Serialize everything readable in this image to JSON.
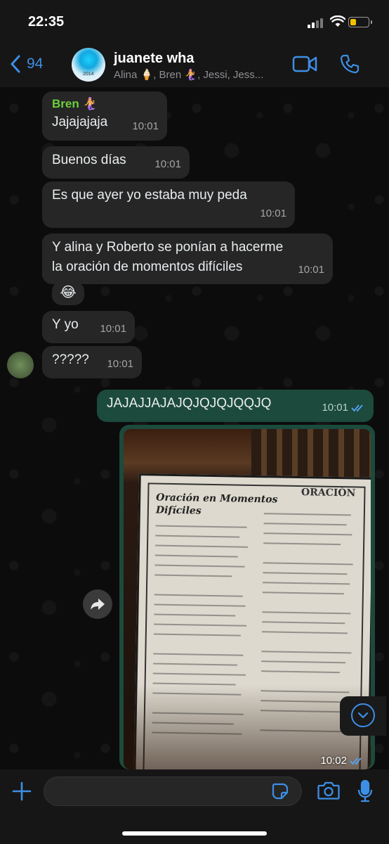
{
  "status": {
    "time": "22:35"
  },
  "header": {
    "back_count": "94",
    "avatar_caption": "2014",
    "title": "juanete wha",
    "subtitle": "Alina 🍦, Bren 🧜‍♀️, Jessi, Jess..."
  },
  "messages": [
    {
      "sender": "Bren 🧜‍♀️",
      "text": "Jajajajaja",
      "time": "10:01"
    },
    {
      "text": "Buenos días",
      "time": "10:01"
    },
    {
      "text": "Es que ayer yo estaba muy peda",
      "time": "10:01"
    },
    {
      "text_line1": "Y alina y Roberto se ponían a hacerme",
      "text_line2": "la oración de momentos difíciles",
      "time": "10:01"
    },
    {
      "text": "😂"
    },
    {
      "text": "Y yo",
      "time": "10:01"
    },
    {
      "text": "?????",
      "time": "10:01"
    },
    {
      "text": "JAJAJJAJAJQJQJQJQQJQ",
      "time": "10:01"
    },
    {
      "time": "10:02"
    }
  ],
  "photo": {
    "title_line1": "Oración en Momentos",
    "title_line2": "Difíciles",
    "right_title": "ORACIÓN"
  },
  "colors": {
    "accent": "#3d8fe5",
    "outgoing_bubble": "#1c4a3c",
    "incoming_bubble": "#262626",
    "sender_name": "#6bcf3b"
  },
  "icons": [
    "back-chevron-icon",
    "video-call-icon",
    "phone-icon",
    "forward-icon",
    "scroll-down-icon",
    "plus-icon",
    "sticker-icon",
    "camera-icon",
    "mic-icon"
  ]
}
